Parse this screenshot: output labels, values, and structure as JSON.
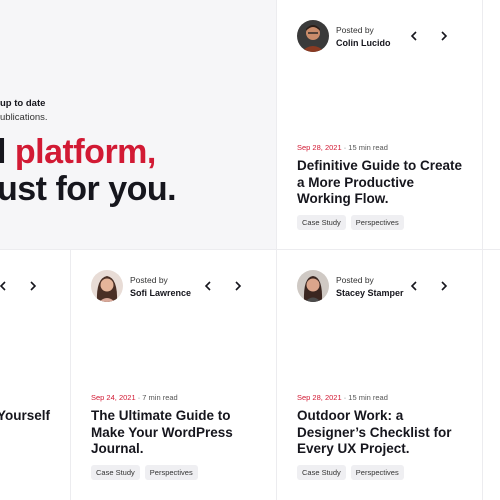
{
  "hero": {
    "subtitle_line1": "up to date",
    "subtitle_line2": "ublications.",
    "headline_prefix": "l ",
    "headline_accent": "platform,",
    "headline_line2": "ust for you."
  },
  "colors": {
    "accent": "#d21a34",
    "hero_bg": "#f6f6f8",
    "tag_bg": "#efeff2"
  },
  "cards": [
    {
      "posted_by": "Posted by",
      "author": "Colin Lucido",
      "date": "Sep 28, 2021",
      "read_time": " · 15 min read",
      "title_lines": [
        "Definitive Guide to Create",
        "a More Productive",
        "Working Flow."
      ],
      "tags": [
        "Case Study",
        "Perspectives"
      ]
    },
    {
      "title_partial": "Yourself"
    },
    {
      "posted_by": "Posted by",
      "author": "Sofi Lawrence",
      "date": "Sep 24, 2021",
      "read_time": " · 7 min read",
      "title_lines": [
        "The Ultimate Guide to",
        "Make Your WordPress",
        "Journal."
      ],
      "tags": [
        "Case Study",
        "Perspectives"
      ]
    },
    {
      "posted_by": "Posted by",
      "author": "Stacey Stamper",
      "date": "Sep 28, 2021",
      "read_time": " · 15 min read",
      "title_lines": [
        "Outdoor Work: a",
        "Designer’s Checklist for",
        "Every UX Project."
      ],
      "tags": [
        "Case Study",
        "Perspectives"
      ]
    }
  ],
  "icons": {
    "prev": "chevron-left-icon",
    "next": "chevron-right-icon"
  }
}
